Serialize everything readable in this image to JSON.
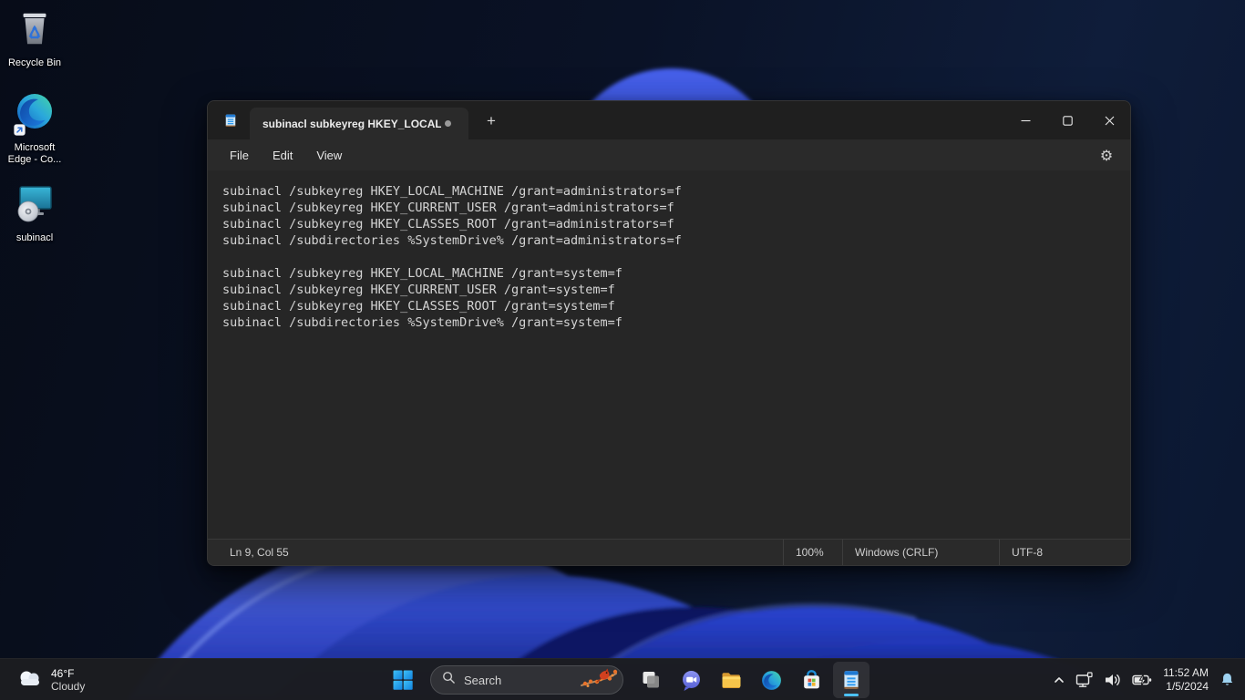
{
  "desktop": {
    "recycle_bin_label": "Recycle Bin",
    "edge_label_line1": "Microsoft",
    "edge_label_line2": "Edge - Co...",
    "subinacl_label": "subinacl"
  },
  "window": {
    "tab_title": "subinacl subkeyreg HKEY_LOCAL_M",
    "new_tab_glyph": "+",
    "menu": {
      "file": "File",
      "edit": "Edit",
      "view": "View"
    },
    "editor_lines": [
      "subinacl /subkeyreg HKEY_LOCAL_MACHINE /grant=administrators=f",
      "subinacl /subkeyreg HKEY_CURRENT_USER /grant=administrators=f",
      "subinacl /subkeyreg HKEY_CLASSES_ROOT /grant=administrators=f",
      "subinacl /subdirectories %SystemDrive% /grant=administrators=f",
      "",
      "subinacl /subkeyreg HKEY_LOCAL_MACHINE /grant=system=f",
      "subinacl /subkeyreg HKEY_CURRENT_USER /grant=system=f",
      "subinacl /subkeyreg HKEY_CLASSES_ROOT /grant=system=f",
      "subinacl /subdirectories %SystemDrive% /grant=system=f"
    ],
    "statusbar": {
      "position": "Ln 9, Col 55",
      "zoom": "100%",
      "line_ending": "Windows (CRLF)",
      "encoding": "UTF-8"
    },
    "settings_glyph": "⚙"
  },
  "taskbar": {
    "weather_temp": "46°F",
    "weather_condition": "Cloudy",
    "search_placeholder": "Search",
    "clock_time": "11:52 AM",
    "clock_date": "1/5/2024"
  },
  "colors": {
    "accent_blue": "#4cc2ff",
    "wallpaper_bloom_blue": "#2b44d8",
    "window_chrome": "#1f1f1f",
    "editor_bg": "#262626",
    "taskbar_bg": "#1c1d21",
    "bell_blue": "#9fd3f2"
  }
}
